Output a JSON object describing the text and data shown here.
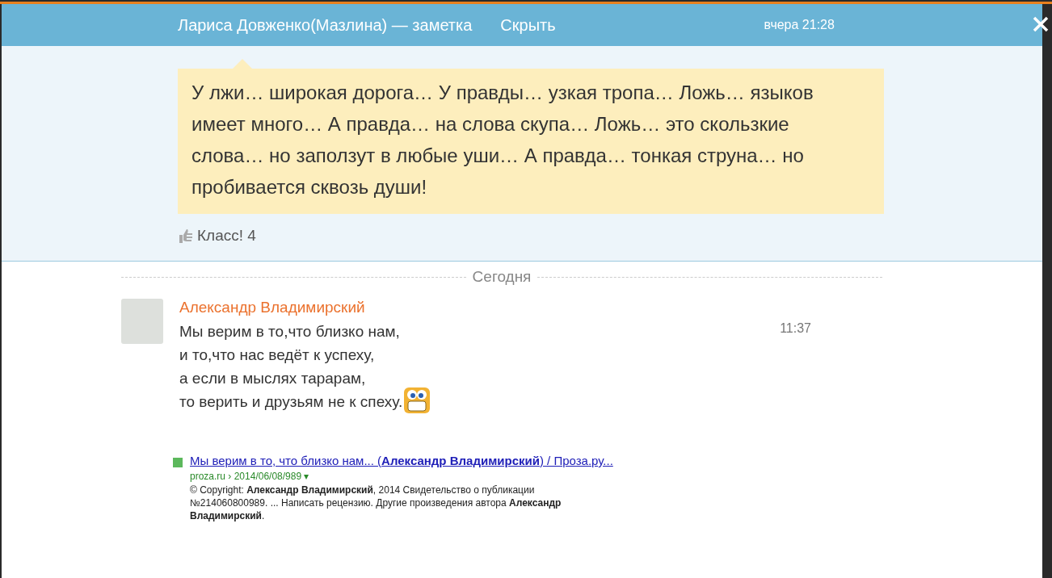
{
  "header": {
    "title": "Лариса Довженко(Мазлина) — заметка",
    "hide": "Скрыть",
    "time": "вчера 21:28"
  },
  "note": {
    "text": "У лжи… широкая дорога… У правды… узкая тропа… Ложь… языков имеет много… А правда… на слова скупа… Ложь… это скользкие слова… но заползут в любые уши… А правда… тонкая струна… но пробивается сквозь души!",
    "likes": "Класс! 4"
  },
  "divider": "Сегодня",
  "comment": {
    "author": "Александр Владимирский",
    "time": "11:37",
    "lines": [
      "Мы верим в то,что близко нам,",
      "и то,что нас ведёт к успеху,",
      "а если в мыслях тарарам,",
      "то верить и друзьям не к спеху."
    ]
  },
  "search_result": {
    "title": "Мы верим в то, что близко нам... (**Александр Владимирский**) / Проза.ру...",
    "url": "proza.ru › 2014/06/08/989 ▾",
    "snippet": "© Copyright: **Александр Владимирский**, 2014 Свидетельство о публикации №214060800989. ... Написать рецензию. Другие произведения автора **Александр Владимирский**."
  }
}
